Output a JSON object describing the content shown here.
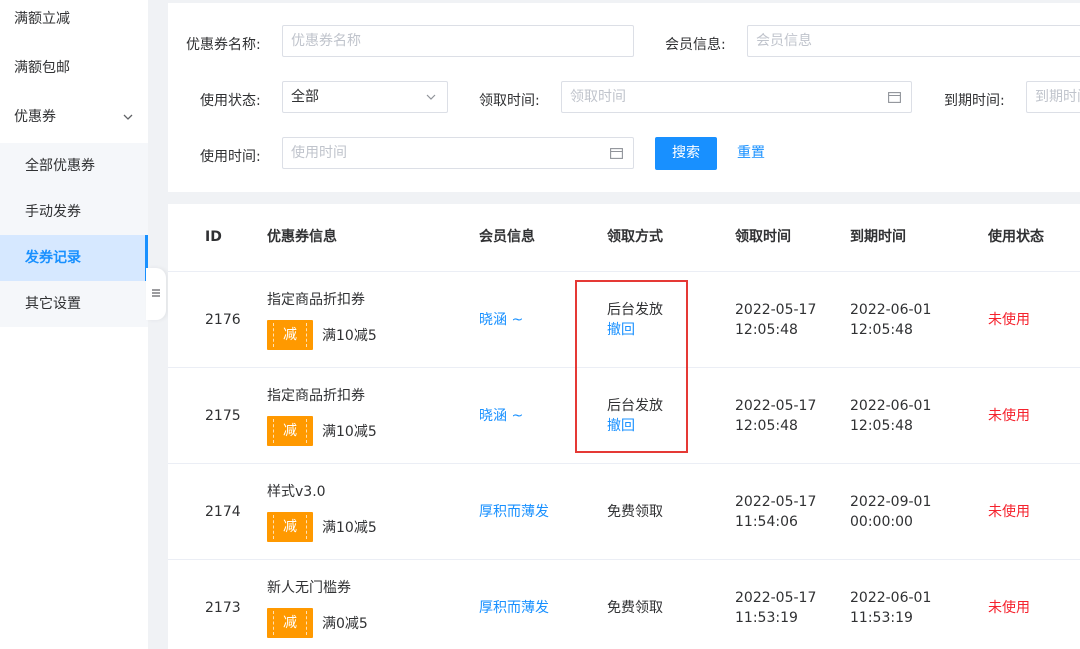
{
  "sidebar": {
    "items": [
      {
        "label": "满额立减"
      },
      {
        "label": "满额包邮"
      },
      {
        "label": "优惠券"
      },
      {
        "label": "全部优惠券"
      },
      {
        "label": "手动发券"
      },
      {
        "label": "发券记录"
      },
      {
        "label": "其它设置"
      }
    ]
  },
  "filters": {
    "coupon_name": {
      "label": "优惠券名称:",
      "placeholder": "优惠券名称"
    },
    "member_info": {
      "label": "会员信息:",
      "placeholder": "会员信息"
    },
    "use_status": {
      "label": "使用状态:",
      "value": "全部"
    },
    "receive_time": {
      "label": "领取时间:",
      "placeholder": "领取时间"
    },
    "expire_time": {
      "label": "到期时间:",
      "placeholder": "到期时间"
    },
    "use_time": {
      "label": "使用时间:",
      "placeholder": "使用时间"
    },
    "search_label": "搜索",
    "reset_label": "重置"
  },
  "table": {
    "columns": [
      "ID",
      "优惠券信息",
      "会员信息",
      "领取方式",
      "领取时间",
      "到期时间",
      "使用状态"
    ],
    "rows": [
      {
        "id": "2176",
        "coupon_name": "指定商品折扣券",
        "badge": "减",
        "rule": "满10减5",
        "member": "晓涵 ~",
        "method": "后台发放",
        "action": "撤回",
        "receive_date": "2022-05-17",
        "receive_clock": "12:05:48",
        "expire_date": "2022-06-01",
        "expire_clock": "12:05:48",
        "status": "未使用"
      },
      {
        "id": "2175",
        "coupon_name": "指定商品折扣券",
        "badge": "减",
        "rule": "满10减5",
        "member": "晓涵 ~",
        "method": "后台发放",
        "action": "撤回",
        "receive_date": "2022-05-17",
        "receive_clock": "12:05:48",
        "expire_date": "2022-06-01",
        "expire_clock": "12:05:48",
        "status": "未使用"
      },
      {
        "id": "2174",
        "coupon_name": "样式v3.0",
        "badge": "减",
        "rule": "满10减5",
        "member": "厚积而薄发",
        "method": "免费领取",
        "action": "",
        "receive_date": "2022-05-17",
        "receive_clock": "11:54:06",
        "expire_date": "2022-09-01",
        "expire_clock": "00:00:00",
        "status": "未使用"
      },
      {
        "id": "2173",
        "coupon_name": "新人无门槛券",
        "badge": "减",
        "rule": "满0减5",
        "member": "厚积而薄发",
        "method": "免费领取",
        "action": "",
        "receive_date": "2022-05-17",
        "receive_clock": "11:53:19",
        "expire_date": "2022-06-01",
        "expire_clock": "11:53:19",
        "status": "未使用"
      }
    ]
  },
  "colors": {
    "primary": "#1890ff",
    "badge": "#ff9900",
    "status_unused": "#f5222d",
    "highlight": "#e53935"
  }
}
